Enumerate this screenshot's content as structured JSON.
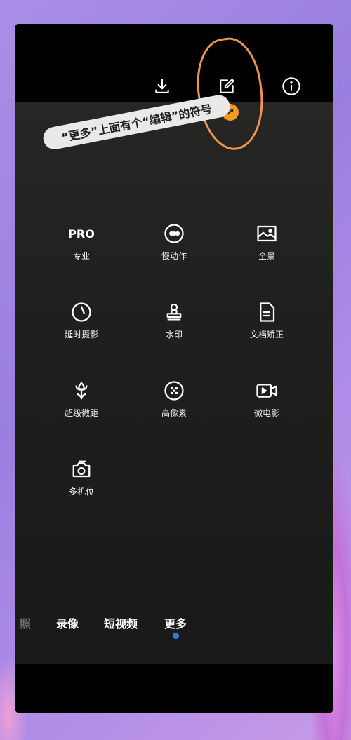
{
  "annotation": {
    "callout_text": "“更多”上面有个“编辑”的符号",
    "dot_glyph": "↗"
  },
  "top_bar": {
    "icons": [
      "download-icon",
      "edit-icon",
      "info-icon"
    ]
  },
  "modes": [
    {
      "icon_text": "PRO",
      "label": "专业"
    },
    {
      "icon_text": "",
      "label": "慢动作"
    },
    {
      "icon_text": "",
      "label": "全景"
    },
    {
      "icon_text": "",
      "label": "延时摄影"
    },
    {
      "icon_text": "",
      "label": "水印"
    },
    {
      "icon_text": "",
      "label": "文档矫正"
    },
    {
      "icon_text": "",
      "label": "超级微距"
    },
    {
      "icon_text": "",
      "label": "高像素"
    },
    {
      "icon_text": "",
      "label": "微电影"
    },
    {
      "icon_text": "",
      "label": "多机位"
    }
  ],
  "tabs": [
    {
      "label": "照"
    },
    {
      "label": "录像"
    },
    {
      "label": "短视频"
    },
    {
      "label": "更多"
    }
  ],
  "colors": {
    "accent_dot": "#2f7bf6",
    "annotation": "#f0954a"
  }
}
